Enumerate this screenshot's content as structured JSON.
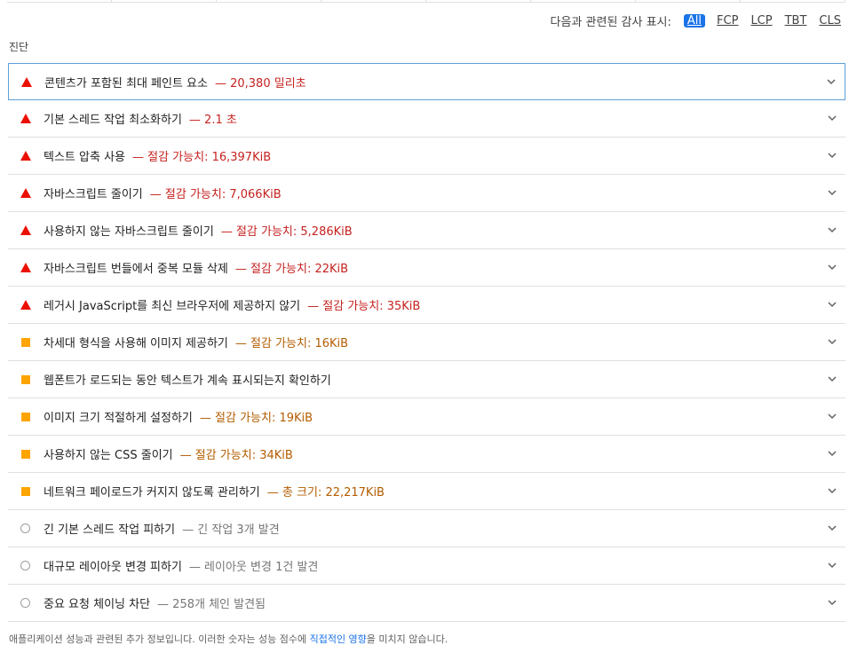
{
  "filter": {
    "label": "다음과 관련된 감사 표시:",
    "chips": [
      "All",
      "FCP",
      "LCP",
      "TBT",
      "CLS"
    ],
    "active": "All"
  },
  "section_title": "진단",
  "audits": [
    {
      "severity": "fail",
      "icon": "red-triangle-icon",
      "title": "콘텐츠가 포함된 최대 페인트 요소",
      "detail": "— 20,380 밀리초"
    },
    {
      "severity": "fail",
      "icon": "red-triangle-icon",
      "title": "기본 스레드 작업 최소화하기",
      "detail": "— 2.1 초"
    },
    {
      "severity": "fail",
      "icon": "red-triangle-icon",
      "title": "텍스트 압축 사용",
      "detail": "— 절감 가능치: 16,397KiB"
    },
    {
      "severity": "fail",
      "icon": "red-triangle-icon",
      "title": "자바스크립트 줄이기",
      "detail": "— 절감 가능치: 7,066KiB"
    },
    {
      "severity": "fail",
      "icon": "red-triangle-icon",
      "title": "사용하지 않는 자바스크립트 줄이기",
      "detail": "— 절감 가능치: 5,286KiB"
    },
    {
      "severity": "fail",
      "icon": "red-triangle-icon",
      "title": "자바스크립트 번들에서 중복 모듈 삭제",
      "detail": "— 절감 가능치: 22KiB"
    },
    {
      "severity": "fail",
      "icon": "red-triangle-icon",
      "title": "레거시 JavaScript를 최신 브라우저에 제공하지 않기",
      "detail": "— 절감 가능치: 35KiB"
    },
    {
      "severity": "avg",
      "icon": "orange-square-icon",
      "title": "차세대 형식을 사용해 이미지 제공하기",
      "detail": "— 절감 가능치: 16KiB"
    },
    {
      "severity": "avg",
      "icon": "orange-square-icon",
      "title": "웹폰트가 로드되는 동안 텍스트가 계속 표시되는지 확인하기",
      "detail": ""
    },
    {
      "severity": "avg",
      "icon": "orange-square-icon",
      "title": "이미지 크기 적절하게 설정하기",
      "detail": "— 절감 가능치: 19KiB"
    },
    {
      "severity": "avg",
      "icon": "orange-square-icon",
      "title": "사용하지 않는 CSS 줄이기",
      "detail": "— 절감 가능치: 34KiB"
    },
    {
      "severity": "avg",
      "icon": "orange-square-icon",
      "title": "네트워크 페이로드가 커지지 않도록 관리하기",
      "detail": "— 총 크기: 22,217KiB"
    },
    {
      "severity": "info",
      "icon": "gray-circle-icon",
      "title": "긴 기본 스레드 작업 피하기",
      "detail": "— 긴 작업 3개 발견"
    },
    {
      "severity": "info",
      "icon": "gray-circle-icon",
      "title": "대규모 레이아웃 변경 피하기",
      "detail": "— 레이아웃 변경 1건 발견"
    },
    {
      "severity": "info",
      "icon": "gray-circle-icon",
      "title": "중요 요청 체이닝 차단",
      "detail": "— 258개 체인 발견됨"
    }
  ],
  "footer": {
    "text_before": "애플리케이션 성능과 관련된 추가 정보입니다. 이러한 숫자는 성능 점수에 ",
    "link": "직접적인 영향",
    "text_after": "을 미치지 않습니다."
  },
  "colors": {
    "fail": "#eb0f00",
    "average": "#ffa400",
    "info": "#9e9e9e",
    "accent": "#1a73e8"
  }
}
